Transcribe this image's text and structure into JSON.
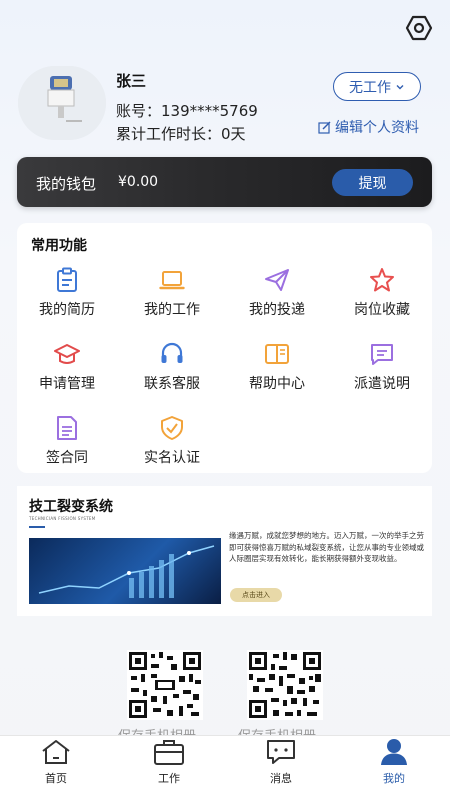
{
  "profile": {
    "name": "张三",
    "account": "账号：139****5769",
    "work_time": "累计工作时长：0天",
    "status_label": "无工作",
    "edit_label": "编辑个人资料"
  },
  "wallet": {
    "label": "我的钱包",
    "amount": "¥0.00",
    "withdraw_label": "提现"
  },
  "functions": {
    "title": "常用功能",
    "items": [
      {
        "label": "我的简历",
        "icon": "resume-icon",
        "color": "#3f78d6"
      },
      {
        "label": "我的工作",
        "icon": "laptop-icon",
        "color": "#f2a33a"
      },
      {
        "label": "我的投递",
        "icon": "paper-plane-icon",
        "color": "#9b6fe0"
      },
      {
        "label": "岗位收藏",
        "icon": "star-icon",
        "color": "#e8504f"
      },
      {
        "label": "申请管理",
        "icon": "graduation-cap-icon",
        "color": "#e24b4b"
      },
      {
        "label": "联系客服",
        "icon": "headset-icon",
        "color": "#3f78d6"
      },
      {
        "label": "帮助中心",
        "icon": "book-icon",
        "color": "#f2a33a"
      },
      {
        "label": "派遣说明",
        "icon": "message-icon",
        "color": "#9b6fe0"
      },
      {
        "label": "签合同",
        "icon": "document-icon",
        "color": "#9b6fe0"
      },
      {
        "label": "实名认证",
        "icon": "shield-check-icon",
        "color": "#f2a33a"
      }
    ]
  },
  "fission": {
    "title": "技工裂变系统",
    "subtitle": "TECHNICIAN FISSION SYSTEM",
    "description": "缘遇万赋，成就您梦想的地方。迈入万赋，一次的举手之劳即可获得惊喜万赋的私域裂变系统，让您从事的专业领域或人际圈层实现有效转化，能长期获得额外变现收益。",
    "cta_label": "点击进入"
  },
  "qr_captions": [
    "保存手机相册",
    "保存手机相册"
  ],
  "tabbar": {
    "items": [
      {
        "label": "首页",
        "icon": "home-icon",
        "active": false
      },
      {
        "label": "工作",
        "icon": "briefcase-icon",
        "active": false
      },
      {
        "label": "消息",
        "icon": "chat-icon",
        "active": false
      },
      {
        "label": "我的",
        "icon": "user-icon",
        "active": true
      }
    ]
  },
  "colors": {
    "primary": "#2a5caa",
    "link": "#2f5db0"
  }
}
